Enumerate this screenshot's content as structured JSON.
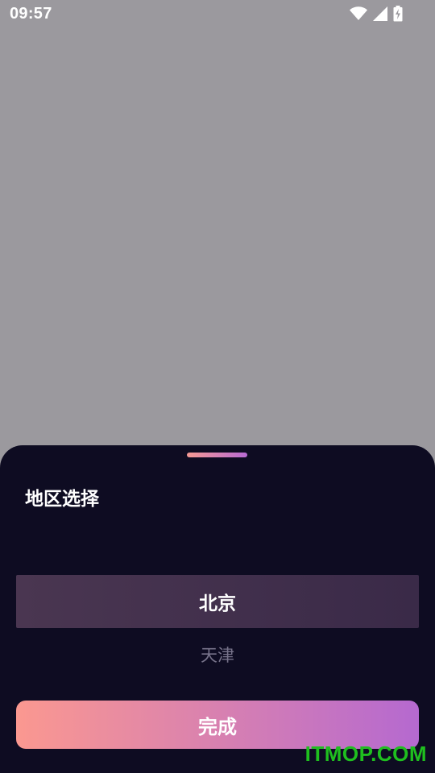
{
  "status_bar": {
    "time": "09:57",
    "icons": [
      "wifi-icon",
      "signal-icon",
      "battery-charging-icon"
    ]
  },
  "sheet": {
    "title": "地区选择",
    "options": [
      {
        "label": "北京",
        "selected": true
      },
      {
        "label": "天津",
        "selected": false
      }
    ],
    "done_label": "完成"
  },
  "watermark": "ITMOP.COM",
  "colors": {
    "overlay": "#9b999e",
    "sheet_bg": "#0e0c22",
    "gradient_start": "#fb9890",
    "gradient_end": "#b569d0",
    "watermark": "#1fbf1f"
  }
}
